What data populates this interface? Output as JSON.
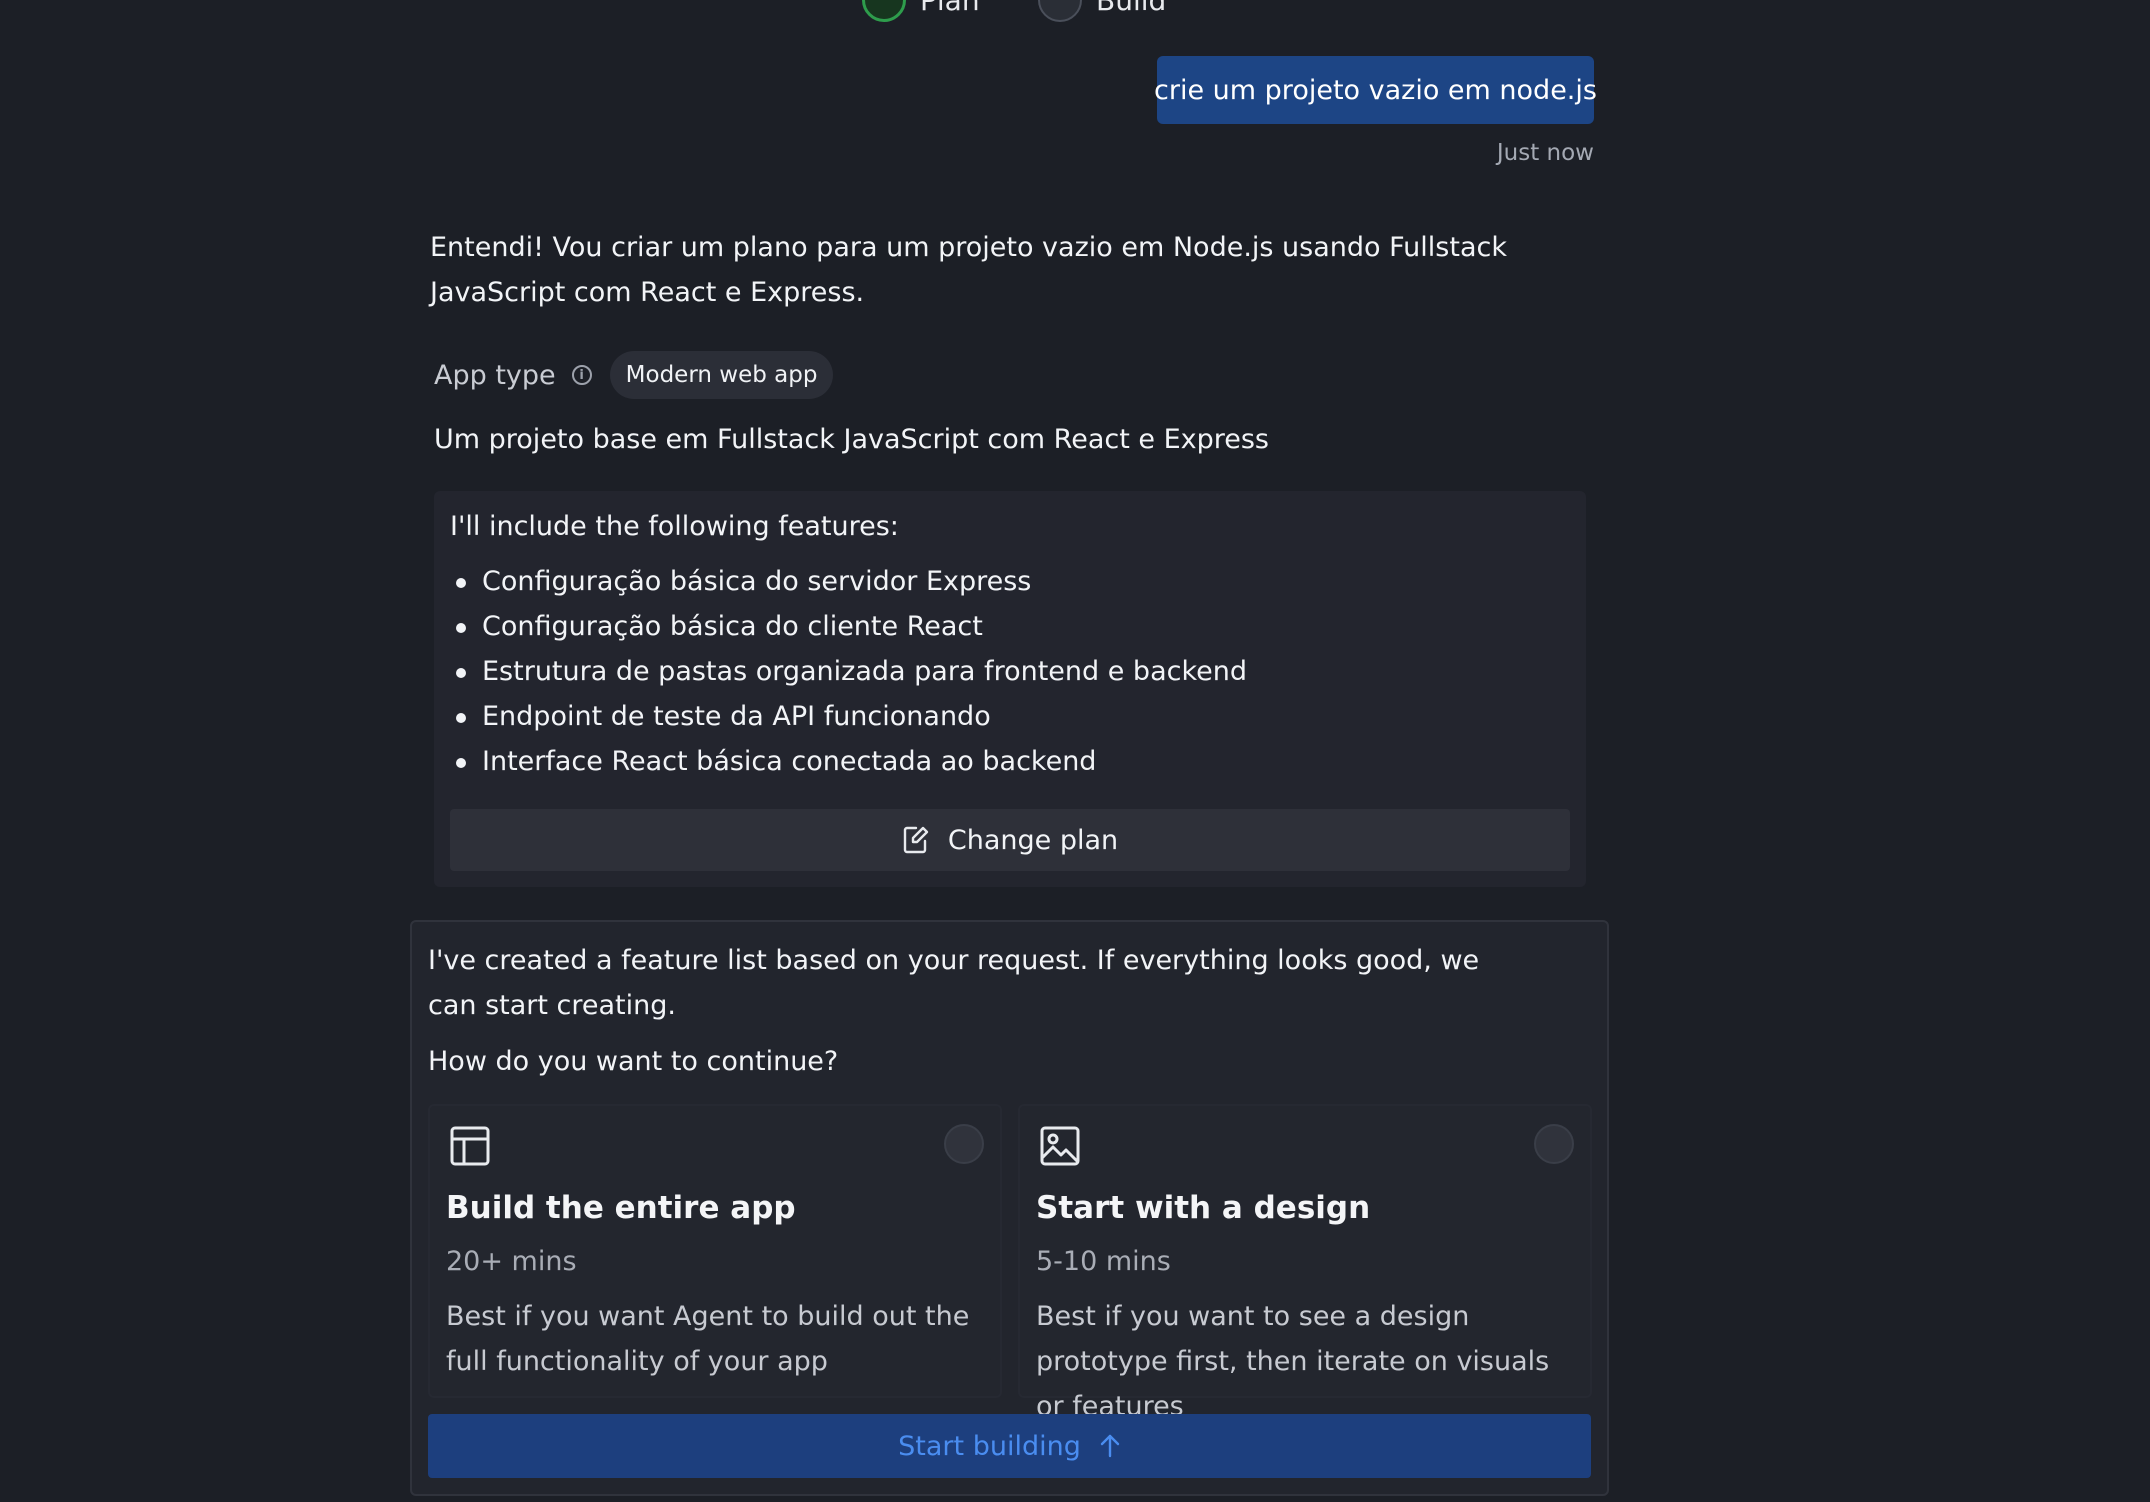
{
  "top_nav": {
    "plan_label": "Plan",
    "build_label": "Build"
  },
  "user_message": {
    "text": "crie um projeto vazio em node.js",
    "timestamp": "Just now"
  },
  "agent_reply": {
    "text": "Entendi! Vou criar um plano para um projeto vazio em Node.js usando Fullstack JavaScript com React e Express.",
    "app_type_label": "App type",
    "app_type_value": "Modern web app",
    "summary": "Um projeto base em Fullstack JavaScript com React e Express",
    "features_intro": "I'll include the following features:",
    "features": [
      "Configuração básica do servidor Express",
      "Configuração básica do cliente React",
      "Estrutura de pastas organizada para frontend e backend",
      "Endpoint de teste da API funcionando",
      "Interface React básica conectada ao backend"
    ],
    "change_plan_label": "Change plan"
  },
  "continue_panel": {
    "message": "I've created a feature list based on your request. If everything looks good, we can start creating.",
    "question": "How do you want to continue?",
    "options": [
      {
        "icon": "layout-icon",
        "title": "Build the entire app",
        "time": "20+ mins",
        "description": "Best if you want Agent to build out the full functionality of your app"
      },
      {
        "icon": "image-icon",
        "title": "Start with a design",
        "time": "5-10 mins",
        "description": "Best if you want to see a design prototype first, then iterate on visuals or features"
      }
    ],
    "start_button_label": "Start building"
  },
  "colors": {
    "background": "#1c1f26",
    "user_bubble": "#1d4585",
    "start_button": "#1d3f7e",
    "start_button_text": "#4a8df0",
    "plan_green": "#2e9d4c"
  }
}
